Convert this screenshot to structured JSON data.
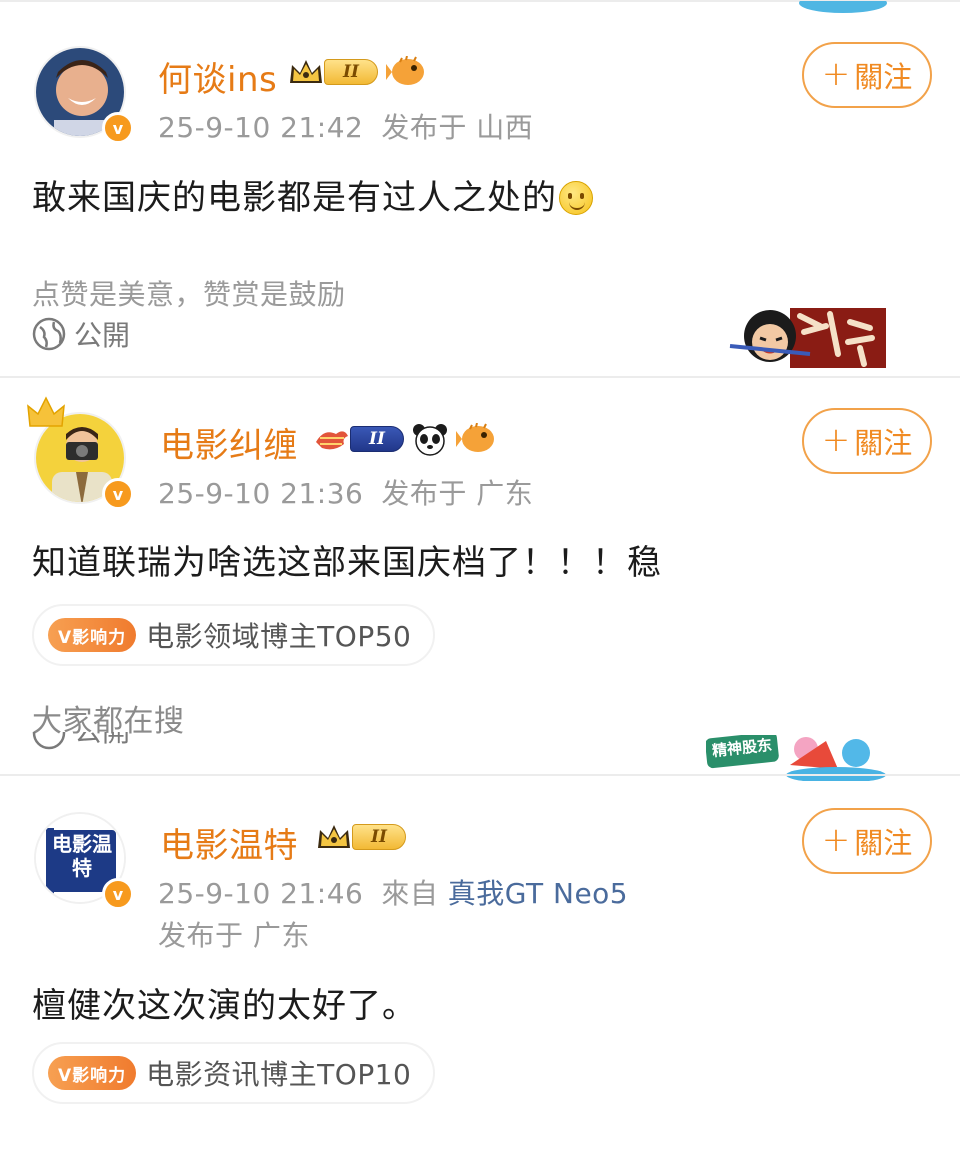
{
  "posts": [
    {
      "username": "何谈ins",
      "rank_label": "II",
      "timestamp": "25-9-10 21:42",
      "location": "发布于 山西",
      "follow_label": "關注",
      "content": "敢来国庆的电影都是有过人之处的",
      "reward_text": "点赞是美意，赞赏是鼓励",
      "visibility": "公開"
    },
    {
      "username": "电影纠缠",
      "rank_label": "II",
      "timestamp": "25-9-10 21:36",
      "location": "发布于 广东",
      "follow_label": "關注",
      "content": "知道联瑞为啥选这部来国庆档了！！！稳",
      "influence_badge": "V影响力",
      "influence_text": "电影领域博主TOP50",
      "search_hint": "大家都在搜",
      "visibility": "公開",
      "sticker_text": "精神股东"
    },
    {
      "username": "电影温特",
      "rank_label": "II",
      "timestamp": "25-9-10 21:46",
      "source_prefix": "來自",
      "device": "真我GT Neo5",
      "location": "发布于 广东",
      "follow_label": "關注",
      "content": "檀健次这次演的太好了。",
      "influence_badge": "V影响力",
      "influence_text": "电影资讯博主TOP10",
      "avatar_text": "电影温特"
    }
  ],
  "colors": {
    "username": "#e67b16",
    "follow_border": "#f2a24a",
    "meta": "#9a9a9a",
    "device_link": "#4a6b9c",
    "verified": "#f79a1e"
  }
}
